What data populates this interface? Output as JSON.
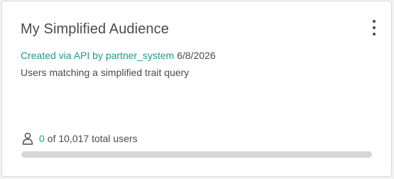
{
  "card": {
    "title": "My Simplified Audience",
    "created_link": "Created via API by partner_system",
    "created_date": "6/8/2026",
    "description": "Users matching a simplified trait query",
    "users": {
      "count": "0",
      "total_text": "of 10,017 total users",
      "icon": "person-icon",
      "progress_fraction": 0
    }
  },
  "colors": {
    "accent": "#1a9a8a",
    "text": "#4a4a4a",
    "track": "#d6d6d6"
  }
}
